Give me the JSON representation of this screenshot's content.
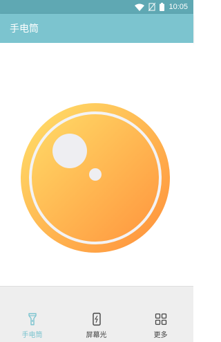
{
  "status_bar": {
    "time": "10:05",
    "icons": [
      "wifi-icon",
      "no-sim-icon",
      "battery-icon"
    ]
  },
  "app_bar": {
    "title": "手电筒"
  },
  "lamp": {
    "icon": "flashlight-lamp-icon",
    "colors": {
      "gradient_start": "#ffe16b",
      "gradient_end": "#ff8f3a",
      "ring": "#f3f3f5",
      "highlight": "#eeeef2"
    }
  },
  "bottom_nav": {
    "active_index": 0,
    "items": [
      {
        "label": "手电筒",
        "icon": "flashlight-icon"
      },
      {
        "label": "屏幕光",
        "icon": "phone-screen-icon"
      },
      {
        "label": "更多",
        "icon": "grid-more-icon"
      }
    ]
  },
  "colors": {
    "status_bar": "#5fa8b3",
    "app_bar": "#7cc4cf",
    "accent": "#7cc4cf",
    "nav_background": "#eeeeee"
  }
}
